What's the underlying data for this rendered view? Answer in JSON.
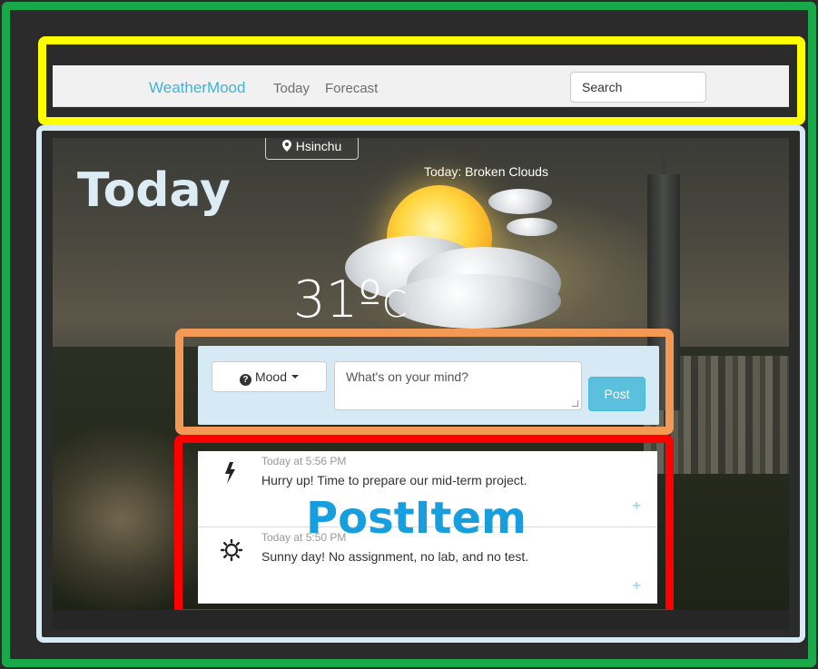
{
  "navbar": {
    "brand": "WeatherMood",
    "links": [
      "Today",
      "Forecast"
    ],
    "search_placeholder": "Search"
  },
  "weather": {
    "location": "Hsinchu",
    "condition": "Today: Broken Clouds",
    "temperature": "31º",
    "unit": "C"
  },
  "labels": {
    "today": "Today",
    "postitem": "PostItem"
  },
  "post_form": {
    "mood_label": "Mood",
    "input_placeholder": "What's on your mind?",
    "post_button": "Post"
  },
  "posts": [
    {
      "time": "Today at 5:56 PM",
      "text": "Hurry up! Time to prepare our mid-term project.",
      "icon": "lightning-icon",
      "plus": "+"
    },
    {
      "time": "Today at 5:50 PM",
      "text": "Sunny day! No assignment, no lab, and no test.",
      "icon": "sun-icon",
      "plus": "+"
    }
  ],
  "colors": {
    "outer_outline": "#19a94a",
    "navbar_outline": "#ffff00",
    "today_outline": "#d8ebf5",
    "form_outline": "#f29a55",
    "postitem_outline": "#ff0000",
    "brand": "#3fb4d6",
    "post_button": "#5bc0de"
  }
}
